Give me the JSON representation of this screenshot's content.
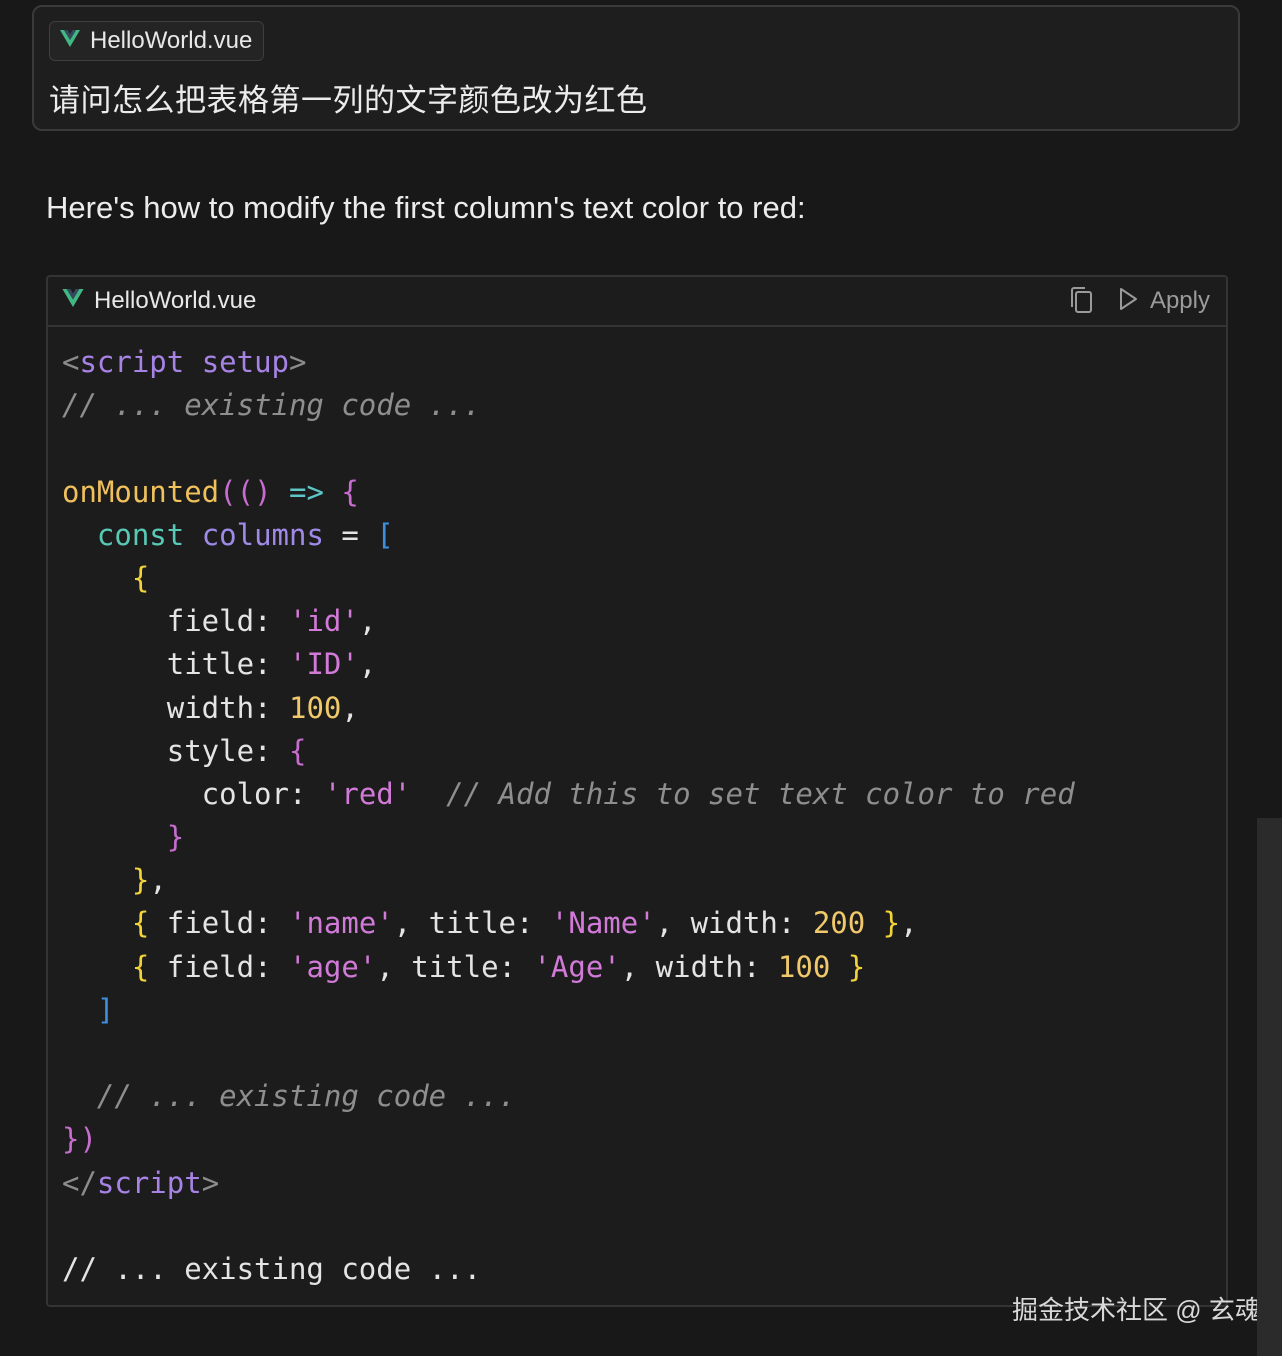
{
  "user_message": {
    "file_chip": {
      "icon": "vue-icon",
      "filename": "HelloWorld.vue"
    },
    "question": "请问怎么把表格第一列的文字颜色改为红色"
  },
  "answer": {
    "intro": "Here's how to modify the first column's text color to red:"
  },
  "code_block": {
    "filename": "HelloWorld.vue",
    "file_icon": "vue-icon",
    "copy_icon": "copy-icon",
    "apply_icon": "play-icon",
    "apply_label": "Apply",
    "lines": [
      [
        [
          "c-tag",
          "<"
        ],
        [
          "c-kw",
          "script"
        ],
        [
          "c-pn",
          " "
        ],
        [
          "c-kw",
          "setup"
        ],
        [
          "c-tag",
          ">"
        ]
      ],
      [
        [
          "c-cm",
          "// ... existing code ..."
        ]
      ],
      [],
      [
        [
          "c-fn",
          "onMounted"
        ],
        [
          "c-pr",
          "("
        ],
        [
          "c-pr",
          "()"
        ],
        [
          "c-pn",
          " "
        ],
        [
          "c-ar",
          "=>"
        ],
        [
          "c-pn",
          " "
        ],
        [
          "c-pr",
          "{"
        ]
      ],
      [
        [
          "c-pn",
          "  "
        ],
        [
          "c-cn",
          "const"
        ],
        [
          "c-pn",
          " "
        ],
        [
          "c-var",
          "columns"
        ],
        [
          "c-pn",
          " = "
        ],
        [
          "c-bb",
          "["
        ]
      ],
      [
        [
          "c-pn",
          "    "
        ],
        [
          "c-by",
          "{"
        ]
      ],
      [
        [
          "c-pn",
          "      field: "
        ],
        [
          "c-st",
          "'id'"
        ],
        [
          "c-pn",
          ","
        ]
      ],
      [
        [
          "c-pn",
          "      title: "
        ],
        [
          "c-st",
          "'ID'"
        ],
        [
          "c-pn",
          ","
        ]
      ],
      [
        [
          "c-pn",
          "      width: "
        ],
        [
          "c-nm",
          "100"
        ],
        [
          "c-pn",
          ","
        ]
      ],
      [
        [
          "c-pn",
          "      style: "
        ],
        [
          "c-pr",
          "{"
        ]
      ],
      [
        [
          "c-pn",
          "        color: "
        ],
        [
          "c-st",
          "'red'"
        ],
        [
          "c-pn",
          "  "
        ],
        [
          "c-cm",
          "// Add this to set text color to red"
        ]
      ],
      [
        [
          "c-pn",
          "      "
        ],
        [
          "c-pr",
          "}"
        ]
      ],
      [
        [
          "c-pn",
          "    "
        ],
        [
          "c-by",
          "}"
        ],
        [
          "c-pn",
          ","
        ]
      ],
      [
        [
          "c-pn",
          "    "
        ],
        [
          "c-by",
          "{"
        ],
        [
          "c-pn",
          " field: "
        ],
        [
          "c-st",
          "'name'"
        ],
        [
          "c-pn",
          ", title: "
        ],
        [
          "c-st",
          "'Name'"
        ],
        [
          "c-pn",
          ", width: "
        ],
        [
          "c-nm",
          "200"
        ],
        [
          "c-pn",
          " "
        ],
        [
          "c-by",
          "}"
        ],
        [
          "c-pn",
          ","
        ]
      ],
      [
        [
          "c-pn",
          "    "
        ],
        [
          "c-by",
          "{"
        ],
        [
          "c-pn",
          " field: "
        ],
        [
          "c-st",
          "'age'"
        ],
        [
          "c-pn",
          ", title: "
        ],
        [
          "c-st",
          "'Age'"
        ],
        [
          "c-pn",
          ", width: "
        ],
        [
          "c-nm",
          "100"
        ],
        [
          "c-pn",
          " "
        ],
        [
          "c-by",
          "}"
        ]
      ],
      [
        [
          "c-pn",
          "  "
        ],
        [
          "c-bb",
          "]"
        ]
      ],
      [],
      [
        [
          "c-pn",
          "  "
        ],
        [
          "c-cm",
          "// ... existing code ..."
        ]
      ],
      [
        [
          "c-pr",
          "})"
        ]
      ],
      [
        [
          "c-tag",
          "</"
        ],
        [
          "c-kw",
          "script"
        ],
        [
          "c-tag",
          ">"
        ]
      ],
      [],
      [
        [
          "c-pn",
          "// ... existing code ..."
        ]
      ]
    ]
  },
  "watermark": "掘金技术社区 @ 玄魂",
  "colors": {
    "background": "#181818",
    "vue_green": "#41b883",
    "string": "#d27ad8",
    "number": "#f0c96a",
    "comment": "#8e8e8e"
  }
}
